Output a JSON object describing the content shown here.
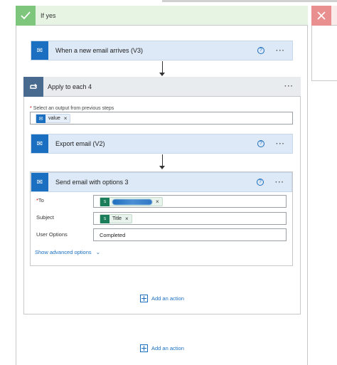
{
  "if_yes": {
    "label": "If yes"
  },
  "trigger": {
    "title": "When a new email arrives (V3)"
  },
  "apply_each": {
    "title": "Apply to each 4",
    "select_label": "Select an output from previous steps",
    "required_mark": "*",
    "token": "value"
  },
  "export_email": {
    "title": "Export email (V2)"
  },
  "send_email": {
    "title": "Send email with options 3",
    "fields": {
      "to_label": "To",
      "to_required": "*",
      "subject_label": "Subject",
      "subject_token": "Title",
      "options_label": "User Options",
      "options_value": "Completed"
    },
    "show_advanced": "Show advanced options"
  },
  "add_action_inner": "Add an action",
  "add_action_outer": "Add an action",
  "icons": {
    "check": "check-icon",
    "close": "close-icon",
    "outlook": "outlook-icon",
    "loop": "loop-icon",
    "help": "help-icon",
    "more": "more-icon",
    "sharepoint": "sharepoint-icon",
    "add": "add-action-icon",
    "chevron": "chevron-down-icon"
  },
  "colors": {
    "success": "#7dc67b",
    "error": "#ea8f8f",
    "outlook_blue": "#1a6fc1",
    "apply_blue": "#496a8f",
    "link": "#1a6fc1"
  },
  "help_glyph": "?",
  "more_glyph": "···",
  "token_close": "×"
}
